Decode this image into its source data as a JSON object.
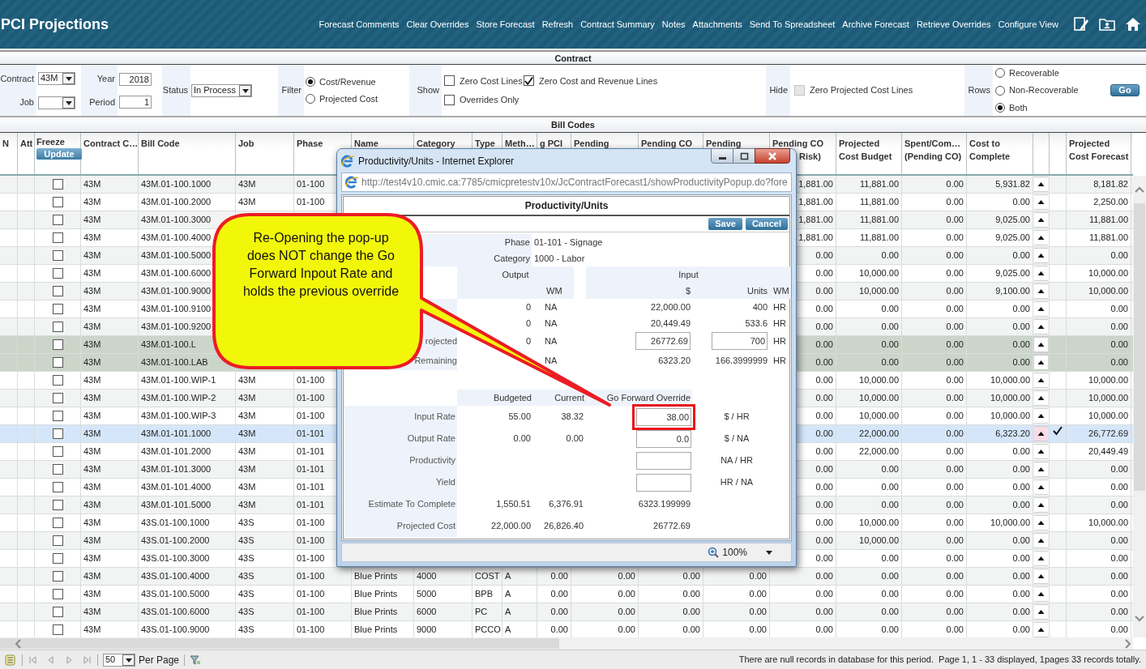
{
  "app": {
    "title": "PCI Projections"
  },
  "toolbar": {
    "links": [
      "Forecast Comments",
      "Clear Overrides",
      "Store Forecast",
      "Refresh",
      "Contract Summary",
      "Notes",
      "Attachments",
      "Send To Spreadsheet",
      "Archive Forecast",
      "Retrieve Overrides",
      "Configure View"
    ]
  },
  "contract_panel": {
    "title": "Contract",
    "contract": {
      "label": "Contract",
      "value": "43M"
    },
    "job": {
      "label": "Job"
    },
    "year": {
      "label": "Year",
      "value": "2018"
    },
    "period": {
      "label": "Period",
      "value": "1"
    },
    "status": {
      "label": "Status",
      "value": "In Process"
    },
    "filter": {
      "label": "Filter",
      "options": [
        {
          "label": "Cost/Revenue",
          "selected": true
        },
        {
          "label": "Projected Cost",
          "selected": false
        }
      ]
    },
    "show": {
      "label": "Show",
      "options": [
        {
          "label": "Zero Cost Lines",
          "checked": false
        },
        {
          "label": "Zero Cost and Revenue Lines",
          "checked": true
        },
        {
          "label": "Overrides Only",
          "checked": false
        }
      ]
    },
    "hide": {
      "label": "Hide",
      "options": [
        {
          "label": "Zero Projected Cost Lines",
          "checked": false,
          "disabled": true
        }
      ]
    },
    "rows_filter": {
      "label": "Rows",
      "options": [
        {
          "label": "Recoverable",
          "selected": false
        },
        {
          "label": "Non-Recoverable",
          "selected": false
        },
        {
          "label": "Both",
          "selected": true
        }
      ]
    },
    "go_button": "Go"
  },
  "bill_codes": {
    "title": "Bill Codes",
    "update_button": "Update",
    "columns": [
      "N",
      "Att",
      "Freeze",
      "Contract C…",
      "Bill Code",
      "Job",
      "Phase",
      "Name",
      "Category",
      "Type",
      "Meth…",
      "g PCI",
      "Pending",
      "Pending CO",
      "Pending",
      "Pending CO\nRisk)",
      "Projected\nCost Budget",
      "Spent/Com…\n(Pending CO)",
      "Cost to\nComplete",
      "Projected\nCost Forecast"
    ],
    "rows": [
      {
        "frozen": false,
        "selected": false,
        "shaded": false,
        "override": false,
        "cells": {
          "contract": "43M",
          "bill_code": "43M.01-100.1000",
          "job": "43M",
          "phase": "01-100",
          "co_risk": "1,881.00",
          "budget": "11,881.00",
          "spent": "0.00",
          "ctc": "5,931.82",
          "forecast": "8,181.82"
        }
      },
      {
        "frozen": false,
        "selected": false,
        "shaded": false,
        "override": false,
        "cells": {
          "contract": "43M",
          "bill_code": "43M.01-100.2000",
          "job": "43M",
          "phase": "01-100",
          "co_risk": "1,881.00",
          "budget": "11,881.00",
          "spent": "0.00",
          "ctc": "0.00",
          "forecast": "2,250.00"
        }
      },
      {
        "frozen": false,
        "selected": false,
        "shaded": false,
        "override": false,
        "cells": {
          "contract": "43M",
          "bill_code": "43M.01-100.3000",
          "co_risk": "1,881.00",
          "budget": "11,881.00",
          "spent": "0.00",
          "ctc": "9,025.00",
          "forecast": "11,881.00"
        }
      },
      {
        "frozen": false,
        "selected": false,
        "shaded": false,
        "override": false,
        "cells": {
          "contract": "43M",
          "bill_code": "43M.01-100.4000",
          "co_risk": "1,881.00",
          "budget": "11,881.00",
          "spent": "0.00",
          "ctc": "9,025.00",
          "forecast": "11,881.00"
        }
      },
      {
        "frozen": false,
        "selected": false,
        "shaded": false,
        "override": false,
        "cells": {
          "contract": "43M",
          "bill_code": "43M.01-100.5000",
          "co_risk": "0.00",
          "budget": "0.00",
          "spent": "0.00",
          "ctc": "0.00",
          "forecast": "0.00"
        }
      },
      {
        "frozen": false,
        "selected": false,
        "shaded": false,
        "override": false,
        "cells": {
          "contract": "43M",
          "bill_code": "43M.01-100.6000",
          "co_risk": "0.00",
          "budget": "10,000.00",
          "spent": "0.00",
          "ctc": "9,025.00",
          "forecast": "10,000.00"
        }
      },
      {
        "frozen": false,
        "selected": false,
        "shaded": false,
        "override": false,
        "cells": {
          "contract": "43M",
          "bill_code": "43M.01-100.9000",
          "co_risk": "0.00",
          "budget": "10,000.00",
          "spent": "0.00",
          "ctc": "9,100.00",
          "forecast": "10,000.00"
        }
      },
      {
        "frozen": false,
        "selected": false,
        "shaded": false,
        "override": false,
        "cells": {
          "contract": "43M",
          "bill_code": "43M.01-100.9100",
          "co_risk": "0.00",
          "budget": "0.00",
          "spent": "0.00",
          "ctc": "0.00",
          "forecast": "0.00"
        }
      },
      {
        "frozen": false,
        "selected": false,
        "shaded": false,
        "override": false,
        "cells": {
          "contract": "43M",
          "bill_code": "43M.01-100.9200",
          "co_risk": "0.00",
          "budget": "0.00",
          "spent": "0.00",
          "ctc": "0.00",
          "forecast": "0.00"
        }
      },
      {
        "frozen": false,
        "selected": false,
        "shaded": true,
        "override": false,
        "cells": {
          "contract": "43M",
          "bill_code": "43M.01-100.L",
          "co_risk": "0.00",
          "budget": "0.00",
          "spent": "0.00",
          "ctc": "0.00",
          "forecast": "0.00"
        }
      },
      {
        "frozen": false,
        "selected": false,
        "shaded": true,
        "override": false,
        "cells": {
          "contract": "43M",
          "bill_code": "43M.01-100.LAB",
          "co_risk": "0.00",
          "budget": "0.00",
          "spent": "0.00",
          "ctc": "0.00",
          "forecast": "0.00"
        }
      },
      {
        "frozen": false,
        "selected": false,
        "shaded": false,
        "override": false,
        "cells": {
          "contract": "43M",
          "bill_code": "43M.01-100.WIP-1",
          "job": "43M",
          "phase": "01-100",
          "co_risk": "0.00",
          "budget": "10,000.00",
          "spent": "0.00",
          "ctc": "10,000.00",
          "forecast": "10,000.00"
        }
      },
      {
        "frozen": false,
        "selected": false,
        "shaded": false,
        "override": false,
        "cells": {
          "contract": "43M",
          "bill_code": "43M.01-100.WIP-2",
          "job": "43M",
          "phase": "01-100",
          "co_risk": "0.00",
          "budget": "10,000.00",
          "spent": "0.00",
          "ctc": "10,000.00",
          "forecast": "10,000.00"
        }
      },
      {
        "frozen": false,
        "selected": false,
        "shaded": false,
        "override": false,
        "cells": {
          "contract": "43M",
          "bill_code": "43M.01-100.WIP-3",
          "job": "43M",
          "phase": "01-100",
          "co_risk": "0.00",
          "budget": "10,000.00",
          "spent": "0.00",
          "ctc": "10,000.00",
          "forecast": "10,000.00"
        }
      },
      {
        "frozen": false,
        "selected": true,
        "shaded": false,
        "override": true,
        "cells": {
          "contract": "43M",
          "bill_code": "43M.01-101.1000",
          "job": "43M",
          "phase": "01-101",
          "co_risk": "0.00",
          "budget": "22,000.00",
          "spent": "0.00",
          "ctc": "6,323.20",
          "forecast": "26,772.69"
        }
      },
      {
        "frozen": false,
        "selected": false,
        "shaded": false,
        "override": false,
        "cells": {
          "contract": "43M",
          "bill_code": "43M.01-101.2000",
          "job": "43M",
          "phase": "01-101",
          "co_risk": "0.00",
          "budget": "22,000.00",
          "spent": "0.00",
          "ctc": "0.00",
          "forecast": "20,449.49"
        }
      },
      {
        "frozen": false,
        "selected": false,
        "shaded": false,
        "override": false,
        "cells": {
          "contract": "43M",
          "bill_code": "43M.01-101.3000",
          "job": "43M",
          "phase": "01-101",
          "co_risk": "0.00",
          "budget": "0.00",
          "spent": "0.00",
          "ctc": "0.00",
          "forecast": "0.00"
        }
      },
      {
        "frozen": false,
        "selected": false,
        "shaded": false,
        "override": false,
        "cells": {
          "contract": "43M",
          "bill_code": "43M.01-101.4000",
          "job": "43M",
          "phase": "01-101",
          "co_risk": "0.00",
          "budget": "0.00",
          "spent": "0.00",
          "ctc": "0.00",
          "forecast": "0.00"
        }
      },
      {
        "frozen": false,
        "selected": false,
        "shaded": false,
        "override": false,
        "cells": {
          "contract": "43M",
          "bill_code": "43M.01-101.5000",
          "job": "43M",
          "phase": "01-101",
          "co_risk": "0.00",
          "budget": "0.00",
          "spent": "0.00",
          "ctc": "0.00",
          "forecast": "0.00"
        }
      },
      {
        "frozen": false,
        "selected": false,
        "shaded": false,
        "override": false,
        "cells": {
          "contract": "43M",
          "bill_code": "43S.01-100.1000",
          "job": "43S",
          "phase": "01-100",
          "co_risk": "0.00",
          "budget": "10,000.00",
          "spent": "0.00",
          "ctc": "10,000.00",
          "forecast": "10,000.00"
        }
      },
      {
        "frozen": false,
        "selected": false,
        "shaded": false,
        "override": false,
        "cells": {
          "contract": "43M",
          "bill_code": "43S.01-100.2000",
          "job": "43S",
          "phase": "01-100",
          "co_risk": "0.00",
          "budget": "10,000.00",
          "spent": "0.00",
          "ctc": "0.00",
          "forecast": "0.00"
        }
      },
      {
        "frozen": false,
        "selected": false,
        "shaded": false,
        "override": false,
        "cells": {
          "contract": "43M",
          "bill_code": "43S.01-100.3000",
          "job": "43S",
          "phase": "01-100",
          "co_risk": "0.00",
          "budget": "0.00",
          "spent": "0.00",
          "ctc": "0.00",
          "forecast": "0.00"
        }
      },
      {
        "frozen": false,
        "selected": false,
        "shaded": false,
        "override": false,
        "cells": {
          "contract": "43M",
          "bill_code": "43S.01-100.4000",
          "job": "43S",
          "phase": "01-100",
          "name": "Blue Prints",
          "category": "4000",
          "type": "COST",
          "method": "A",
          "pci": "0.00",
          "pending": "0.00",
          "pending_co": "0.00",
          "pending_2": "0.00",
          "co_risk": "0.00",
          "budget": "0.00",
          "spent": "0.00",
          "ctc": "0.00",
          "forecast": "0.00"
        }
      },
      {
        "frozen": false,
        "selected": false,
        "shaded": false,
        "override": false,
        "cells": {
          "contract": "43M",
          "bill_code": "43S.01-100.5000",
          "job": "43S",
          "phase": "01-100",
          "name": "Blue Prints",
          "category": "5000",
          "type": "BPB",
          "method": "A",
          "pci": "0.00",
          "pending": "0.00",
          "pending_co": "0.00",
          "pending_2": "0.00",
          "co_risk": "0.00",
          "budget": "0.00",
          "spent": "0.00",
          "ctc": "0.00",
          "forecast": "0.00"
        }
      },
      {
        "frozen": false,
        "selected": false,
        "shaded": false,
        "override": false,
        "cells": {
          "contract": "43M",
          "bill_code": "43S.01-100.6000",
          "job": "43S",
          "phase": "01-100",
          "name": "Blue Prints",
          "category": "6000",
          "type": "PC",
          "method": "A",
          "pci": "0.00",
          "pending": "0.00",
          "pending_co": "0.00",
          "pending_2": "0.00",
          "co_risk": "0.00",
          "budget": "0.00",
          "spent": "0.00",
          "ctc": "0.00",
          "forecast": "0.00"
        }
      },
      {
        "frozen": false,
        "selected": false,
        "shaded": false,
        "override": false,
        "cells": {
          "contract": "43M",
          "bill_code": "43S.01-100.9000",
          "job": "43S",
          "phase": "01-100",
          "name": "Blue Prints",
          "category": "9000",
          "type": "PCCO",
          "method": "A",
          "pci": "0.00",
          "pending": "0.00",
          "pending_co": "0.00",
          "pending_2": "0.00",
          "co_risk": "0.00",
          "budget": "0.00",
          "spent": "0.00",
          "ctc": "0.00",
          "forecast": "0.00"
        }
      }
    ]
  },
  "footer": {
    "page_size": "50",
    "per_page_label": "Per Page",
    "status": "There are null records in database for this period.  Page 1, 1 - 33 displayed, 1pages 33 records totally."
  },
  "popup": {
    "window_title": "Productivity/Units - Internet Explorer",
    "url": "http://test4v10.cmic.ca:7785/cmicpretestv10x/JcContractForecast1/showProductivityPopup.do?fore",
    "heading": "Productivity/Units",
    "buttons": [
      "Save",
      "Cancel"
    ],
    "details": [
      {
        "label": "Phase",
        "value": "01-101 - Signage"
      },
      {
        "label": "Category",
        "value": "1000 - Labor"
      }
    ],
    "output_header": "Output",
    "input_header": "Input",
    "output_wm_header": "WM",
    "amount_header": "$",
    "units_header": "Units",
    "input_wm_header": "WM",
    "quantity_rows": [
      {
        "output": "0",
        "output_wm": "NA",
        "amount": {
          "kind": "text",
          "value": "22,000.00"
        },
        "units": {
          "kind": "text",
          "value": "400"
        },
        "wm": "HR"
      },
      {
        "output": "0",
        "output_wm": "NA",
        "amount": {
          "kind": "text",
          "value": "20,449.49"
        },
        "units": {
          "kind": "text",
          "value": "533.6"
        },
        "wm": "HR"
      },
      {
        "label": "rojected",
        "output": "0",
        "output_wm": "NA",
        "amount": {
          "kind": "field",
          "value": "26772.69"
        },
        "units": {
          "kind": "field",
          "value": "700"
        },
        "wm": "HR"
      },
      {
        "label": "Remaining",
        "output_wm": "NA",
        "amount": {
          "kind": "text",
          "value": "6323.20"
        },
        "units": {
          "kind": "text",
          "value": "166.3999999"
        },
        "wm": "HR"
      }
    ],
    "rate_headers": [
      "Budgeted",
      "Current",
      "Go Forward Override"
    ],
    "rate_rows": [
      {
        "label": "Input Rate",
        "budgeted": "55.00",
        "current": "38.32",
        "override": {
          "kind": "field",
          "value": "38.00",
          "highlighted": true
        },
        "unit": "$ / HR"
      },
      {
        "label": "Output Rate",
        "budgeted": "0.00",
        "current": "0.00",
        "override": {
          "kind": "field",
          "value": "0.0",
          "highlighted": false
        },
        "unit": "$ / NA"
      },
      {
        "label": "Productivity",
        "override": {
          "kind": "field",
          "highlighted": false
        },
        "unit": "NA / HR"
      },
      {
        "label": "Yield",
        "override": {
          "kind": "field",
          "highlighted": false
        },
        "unit": "HR / NA"
      },
      {
        "label": "Estimate To Complete",
        "budgeted": "1,550.51",
        "current": "6,376.91",
        "override": {
          "kind": "text",
          "value": "6323.199999"
        }
      },
      {
        "label": "Projected Cost",
        "budgeted": "22,000.00",
        "current": "26,826.40",
        "override": {
          "kind": "text",
          "value": "26772.69"
        }
      }
    ],
    "zoom": "100%"
  },
  "callout": {
    "text": "Re-Opening the pop-up does NOT change the Go Forward Inpout Rate and holds the previous override"
  }
}
